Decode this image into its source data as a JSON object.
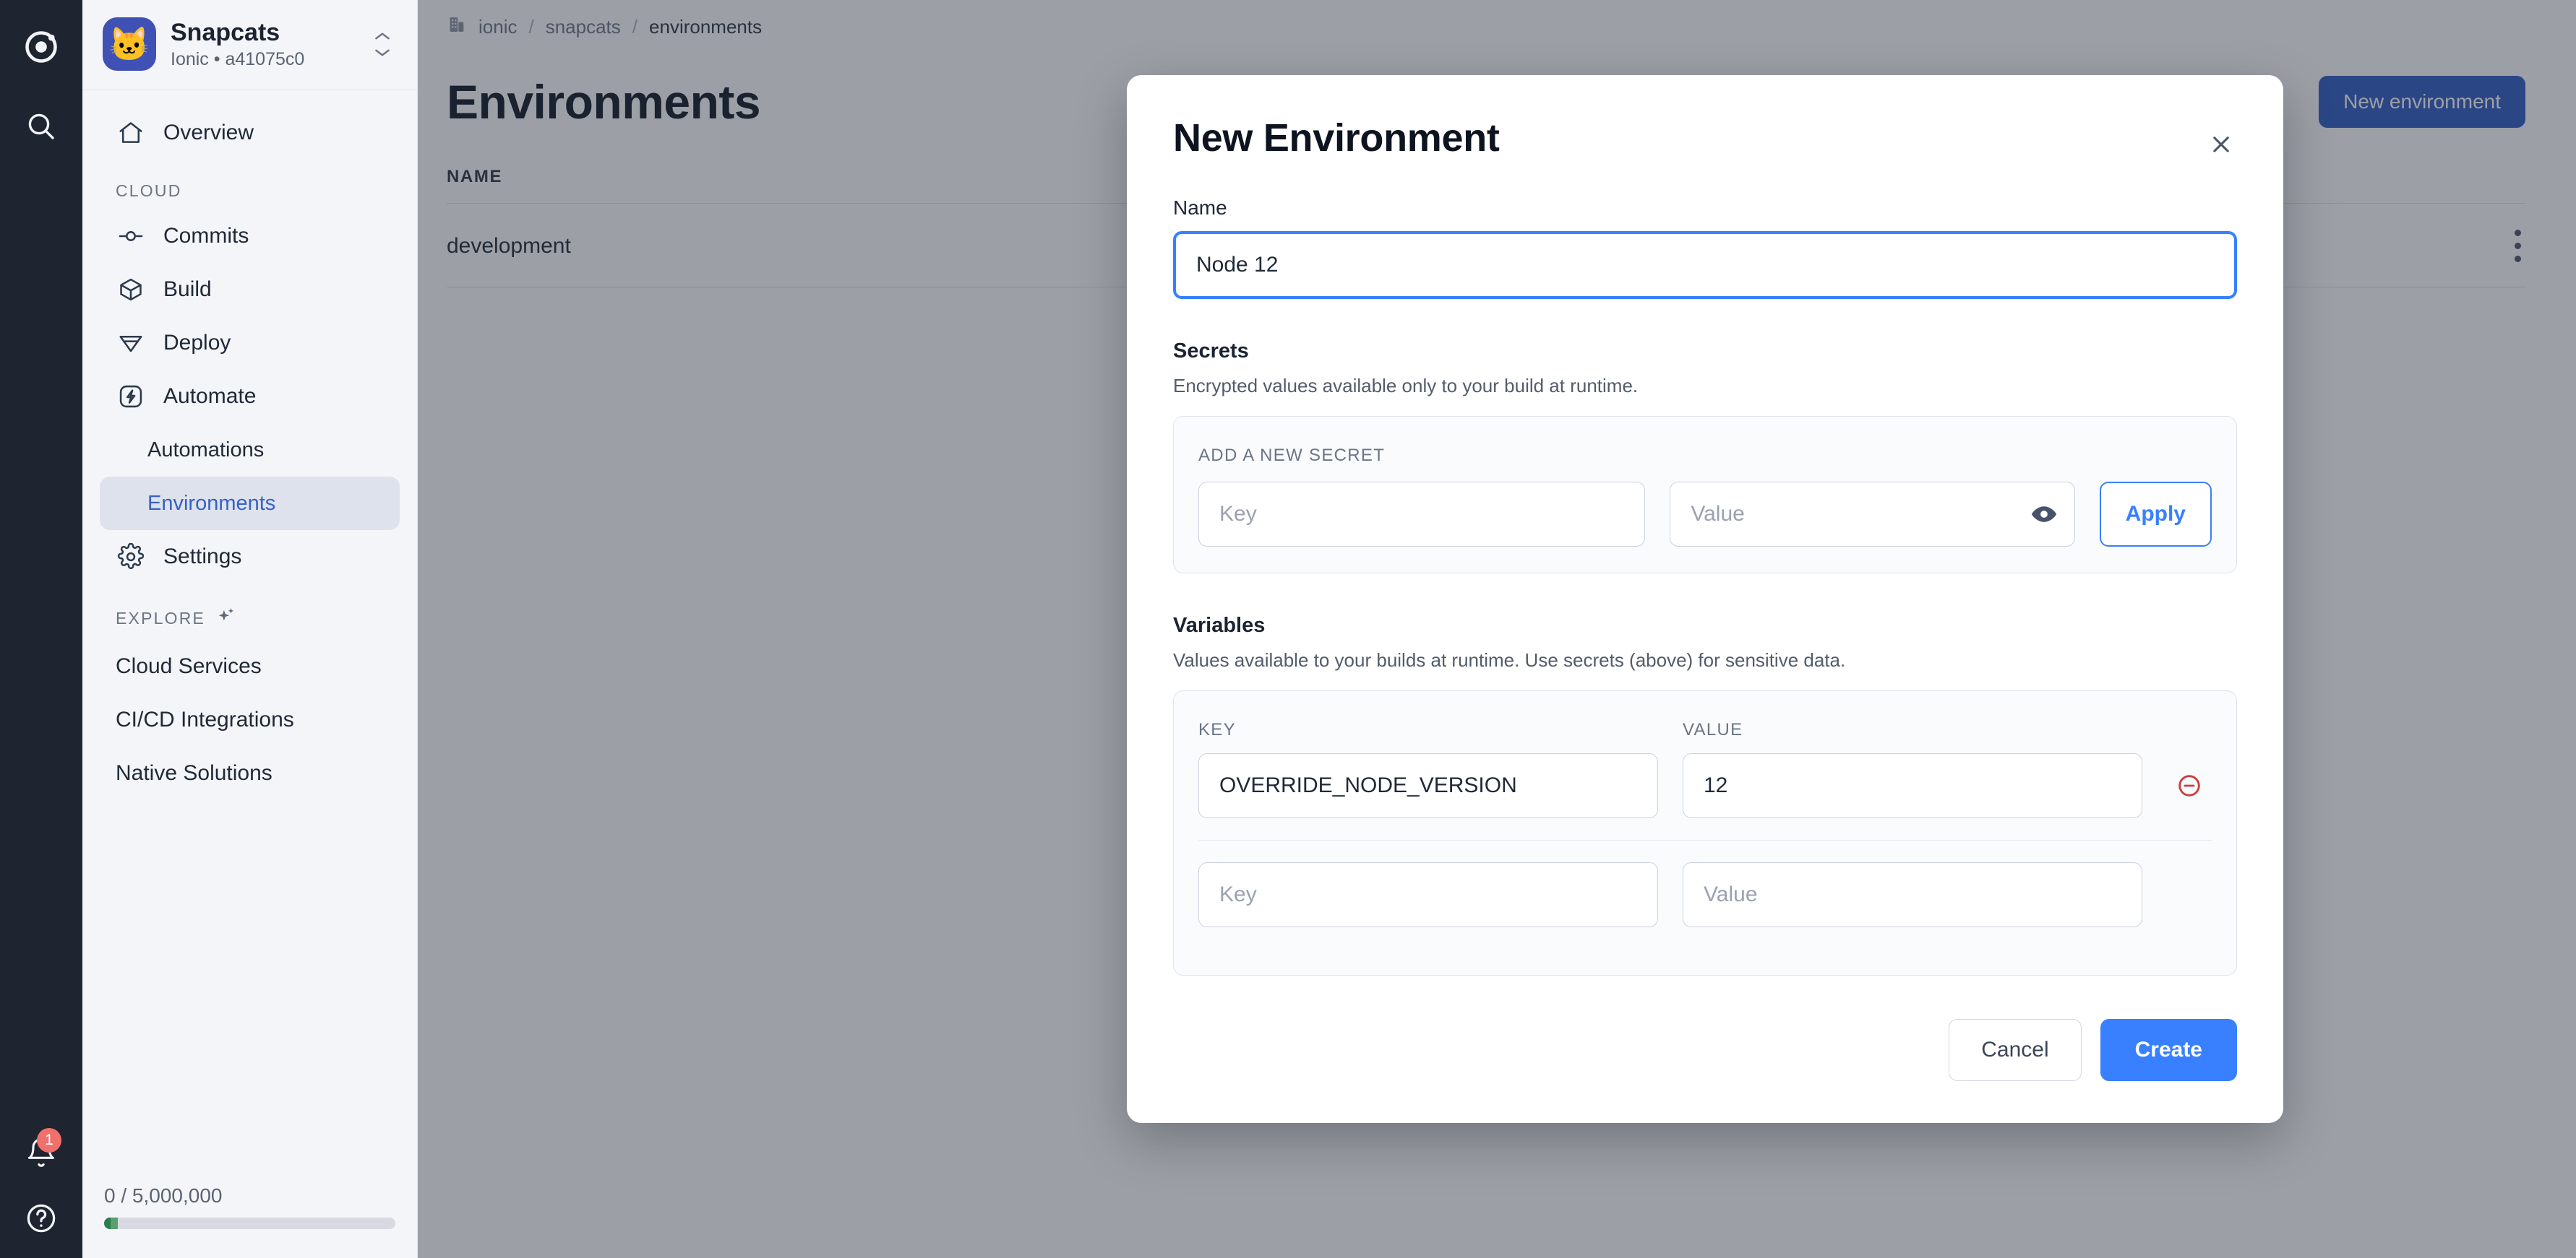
{
  "rail": {
    "logo_icon": "ionic-logo-icon",
    "search_icon": "search-icon",
    "notifications_icon": "bell-icon",
    "notifications_badge": "1",
    "help_icon": "help-circle-icon"
  },
  "sidebar": {
    "project": {
      "avatar_emoji": "🐱",
      "name": "Snapcats",
      "subtitle": "Ionic • a41075c0",
      "switcher_icon": "chevron-up-down-icon"
    },
    "top_items": [
      {
        "label": "Overview",
        "icon": "home-icon"
      }
    ],
    "cloud_section_label": "CLOUD",
    "cloud_items": [
      {
        "label": "Commits",
        "icon": "commit-icon"
      },
      {
        "label": "Build",
        "icon": "cube-icon"
      },
      {
        "label": "Deploy",
        "icon": "deploy-icon"
      },
      {
        "label": "Automate",
        "icon": "bolt-icon"
      }
    ],
    "automate_children": [
      {
        "label": "Automations",
        "active": false
      },
      {
        "label": "Environments",
        "active": true
      }
    ],
    "settings_item": {
      "label": "Settings",
      "icon": "gear-icon"
    },
    "explore_section_label": "EXPLORE",
    "explore_section_icon": "sparkles-icon",
    "explore_items": [
      {
        "label": "Cloud Services"
      },
      {
        "label": "CI/CD Integrations"
      },
      {
        "label": "Native Solutions"
      }
    ],
    "usage": {
      "text": "0 / 5,000,000",
      "fill_color": "#2e7d4f"
    }
  },
  "main": {
    "breadcrumb": {
      "org_icon": "building-icon",
      "items": [
        "ionic",
        "snapcats",
        "environments"
      ],
      "separator": "/"
    },
    "page_title": "Environments",
    "new_environment_button": "New environment",
    "table": {
      "columns": [
        "NAME"
      ],
      "rows": [
        {
          "name": "development",
          "menu_icon": "kebab-menu-icon"
        }
      ]
    }
  },
  "modal": {
    "title": "New Environment",
    "close_icon": "close-icon",
    "name_field": {
      "label": "Name",
      "value": "Node 12",
      "placeholder": "Name"
    },
    "secrets": {
      "title": "Secrets",
      "description": "Encrypted values available only to your build at runtime.",
      "panel_label": "ADD A NEW SECRET",
      "key_placeholder": "Key",
      "key_value": "",
      "value_placeholder": "Value",
      "value_value": "",
      "reveal_icon": "eye-icon",
      "apply_button": "Apply"
    },
    "variables": {
      "title": "Variables",
      "description": "Values available to your builds at runtime. Use secrets (above) for sensitive data.",
      "col_key": "KEY",
      "col_value": "VALUE",
      "rows": [
        {
          "key": "OVERRIDE_NODE_VERSION",
          "value": "12",
          "remove_icon": "circle-minus-icon"
        }
      ],
      "new_row": {
        "key_placeholder": "Key",
        "value_placeholder": "Value"
      }
    },
    "cancel_button": "Cancel",
    "create_button": "Create"
  },
  "colors": {
    "accent_blue": "#3880ff",
    "brand_dark": "#1e2430",
    "danger_red": "#cf3c3c",
    "usage_green": "#2e7d4f"
  }
}
